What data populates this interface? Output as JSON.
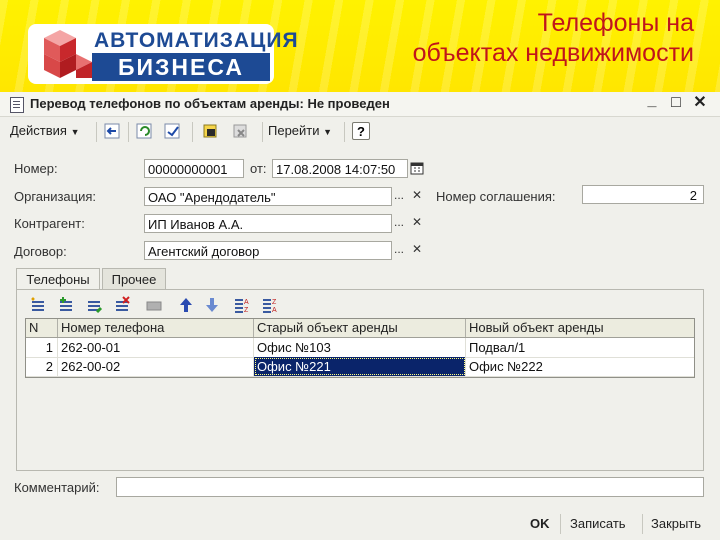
{
  "slide": {
    "title_line1": "Телефоны на",
    "title_line2": "объектах недвижимости",
    "logo_top": "АВТОМАТИЗАЦИЯ",
    "logo_bottom": "БИЗНЕСА"
  },
  "window": {
    "title": "Перевод телефонов по объектам аренды: Не проведен",
    "minimize": "_",
    "maximize": "□",
    "close": "✕"
  },
  "toolbar": {
    "actions_label": "Действия",
    "goto_label": "Перейти",
    "help_label": "?"
  },
  "form": {
    "number_label": "Номер:",
    "number_value": "00000000001",
    "from_label": "от:",
    "date_value": "17.08.2008 14:07:50",
    "org_label": "Организация:",
    "org_value": "ОАО \"Арендодатель\"",
    "agreement_label": "Номер соглашения:",
    "agreement_value": "2",
    "contractor_label": "Контрагент:",
    "contractor_value": "ИП Иванов А.А.",
    "contract_label": "Договор:",
    "contract_value": "Агентский договор",
    "select_btn": "...",
    "clear_btn": "✕"
  },
  "tabs": [
    {
      "label": "Телефоны"
    },
    {
      "label": "Прочее"
    }
  ],
  "table": {
    "columns": [
      "N",
      "Номер телефона",
      "Старый объект аренды",
      "Новый объект аренды"
    ],
    "rows": [
      {
        "n": "1",
        "phone": "262-00-01",
        "old": "Офис №103",
        "new": "Подвал/1"
      },
      {
        "n": "2",
        "phone": "262-00-02",
        "old": "Офис №221",
        "new": "Офис №222"
      }
    ]
  },
  "comment_label": "Комментарий:",
  "comment_value": "",
  "footer": {
    "ok": "OK",
    "save": "Записать",
    "close": "Закрыть"
  }
}
